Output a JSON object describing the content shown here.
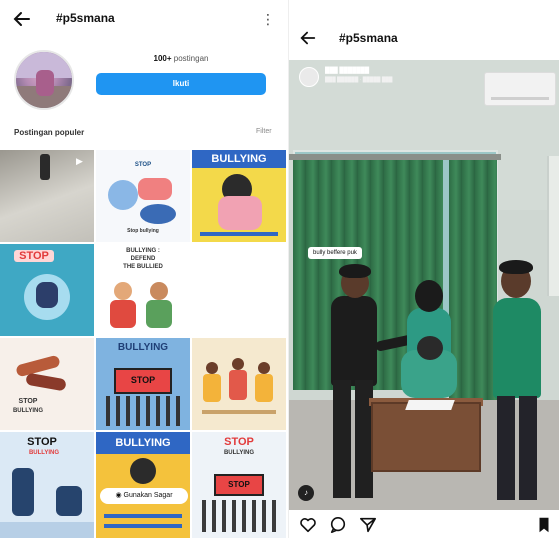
{
  "left": {
    "header": {
      "title": "#p5smana"
    },
    "profile": {
      "posts_count": "100+",
      "posts_label": "postingan",
      "follow_label": "Ikuti"
    },
    "section": {
      "title": "Postingan populer",
      "filter_label": "Filter"
    },
    "grid": {
      "c2_top": "STOP",
      "c2_bottom": "Stop bullying",
      "c3_title": "BULLYING",
      "c4_title": "STOP",
      "c5_line1": "BULLYING :",
      "c5_line2": "DEFEND",
      "c5_line3": "THE BULLIED",
      "c7_title": "STOP",
      "c7_sub": "BULLYING",
      "c8_title": "BULLYING",
      "c8_sign": "STOP",
      "c10_title": "STOP",
      "c10_sub": "BULLYING",
      "c11_title": "BULLYING",
      "c11_button": "Gunakan Sagar",
      "c12_title": "STOP",
      "c12_sub": "BULLYING",
      "c12_sign": "STOP"
    }
  },
  "right": {
    "header": {
      "title": "#p5smana"
    },
    "caption": "bully beffere puk",
    "audio_icon": "speaker-icon",
    "actions": [
      "heart-icon",
      "comment-icon",
      "share-icon",
      "bookmark-icon"
    ]
  },
  "colors": {
    "follow_button": "#1f95f2",
    "curtain": "#2e6d46"
  }
}
